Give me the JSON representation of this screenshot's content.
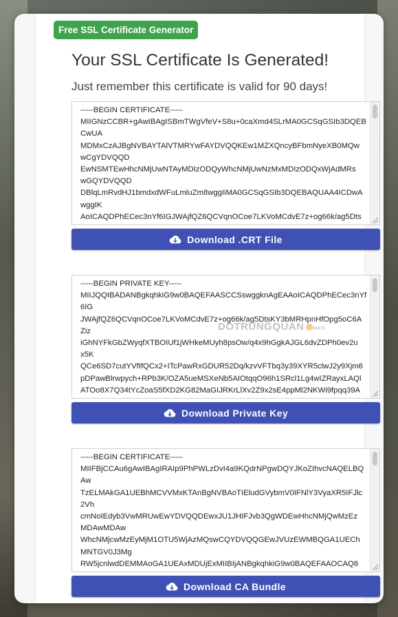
{
  "badge": "Free SSL Certificate Generator",
  "title": "Your SSL Certificate Is Generated!",
  "subtitle": "Just remember this certificate is valid for 90 days!",
  "certificate": {
    "lines": [
      "-----BEGIN CERTIFICATE-----",
      "MIIGNzCCBR+gAwIBAgISBmTWgVfeV+S8u+0caXmd4SLrMA0GCSqGSIb3DQEB",
      "CwUA",
      "MDMxCzAJBgNVBAYTAlVTMRYwFAYDVQQKEw1MZXQncyBFbmNyeXB0MQw",
      "wCgYDVQQD",
      "EwNSMTEwHhcNMjUwNTAyMDIzODQyWhcNMjUwNzMxMDIzODQxWjAdMRs",
      "wGQYDVQQD",
      "DBlqLmRvdHJ1bmdxdWFuLmluZm8wggIiMA0GCSqGSIb3DQEBAQUAA4ICDwA",
      "wggIK",
      "AoICAQDPhECec3nYf6IGJWAjfQZ6QCVqnOCoe7LKVoMCdvE7z+og66k/ag5Dts"
    ],
    "button": "Download .CRT File"
  },
  "private_key": {
    "lines": [
      "-----BEGIN PRIVATE KEY-----",
      "MIIJQQIBADANBgkqhkiG9w0BAQEFAASCCSswggknAgEAAoICAQDPhECec3nYf",
      "6IG",
      "JWAjfQZ6QCVqnOCoe7LKVoMCdvE7z+og66k/ag5DtsKY3bMRHpnHfOpg5oC6A",
      "Ziz",
      "iGhNYFkGbZWyqfXTBOIUf1jWHkeMUyh8psOw/q4x9hGgkAJGL6dvZDPh0ev2u",
      "x5K",
      "QCe6SD7cutYVfIfQCx2+ITcPawRxGDUR52Dq/kzvVFTbq3y39XYR5clwJ2y9Xjm6",
      "pDPawBlrwpych+RPb3K/OZA5ueMSXeNb5AIOtqqO96h1SRcl1Lg4wIZRayxLAQl",
      "ATOo8X7Q34tYcZoaS5fXD2KG82MaGIJRKrLlXv2Z9x2sE4ppMl2NKWi9fpqq39A"
    ],
    "button": "Download Private Key"
  },
  "ca_bundle": {
    "lines": [
      "-----BEGIN CERTIFICATE-----",
      "MIIFBjCCAu6gAwIBAgIRAIp9PhPWLzDvI4a9KQdrNPgwDQYJKoZIhvcNAQELBQ",
      "Aw",
      "TzELMAkGA1UEBhMCVVMxKTAnBgNVBAoTIEludGVybmV0IFNlY3VyaXR5IFJlc",
      "2Vh",
      "cmNoIEdyb3VwMRUwEwYDVQQDEwxJU1JHIFJvb3QgWDEwHhcNMjQwMzEz",
      "MDAwMDAw",
      "WhcNMjcwMzEyMjM1OTU5WjAzMQswCQYDVQQGEwJVUzEWMBQGA1UECh",
      "MNTGV0J3Mg",
      "RW5jcnlwdDEMMAoGA1UEAxMDUjExMIIBIjANBgkqhkiG9w0BAQEFAAOCAQ8"
    ],
    "button": "Download CA Bundle"
  },
  "watermark": "DOTRUNGQUAN",
  "watermark_suffix": "INFO",
  "icons": {
    "download": "cloud-download-icon"
  },
  "colors": {
    "badge": "#3fa34d",
    "button": "#3f51b5"
  }
}
